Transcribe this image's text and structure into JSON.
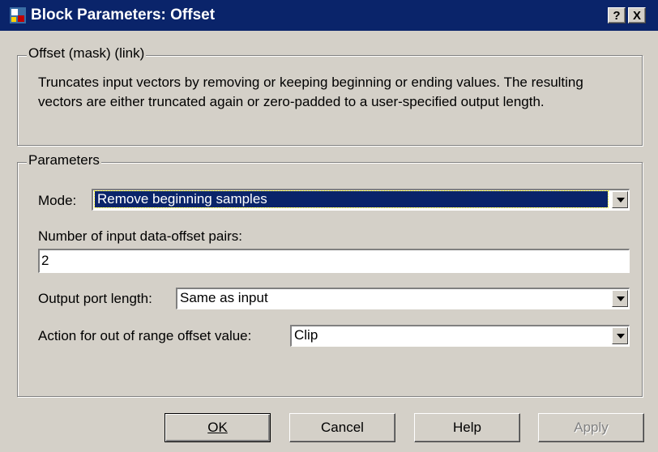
{
  "window": {
    "title": "Block Parameters: Offset",
    "help_button": "?",
    "close_button": "X"
  },
  "description_group": {
    "legend": "Offset (mask) (link)",
    "text": "Truncates input vectors by removing or keeping beginning or ending values. The resulting vectors are either truncated again or zero-padded to a user-specified output length."
  },
  "parameters": {
    "legend": "Parameters",
    "mode_label": "Mode:",
    "mode_value": "Remove beginning samples",
    "pairs_label": "Number of input data-offset pairs:",
    "pairs_value": "2",
    "output_len_label": "Output port length:",
    "output_len_value": "Same as input",
    "action_label": "Action for out of range offset value:",
    "action_value": "Clip"
  },
  "buttons": {
    "ok": "OK",
    "cancel": "Cancel",
    "help": "Help",
    "apply": "Apply"
  }
}
